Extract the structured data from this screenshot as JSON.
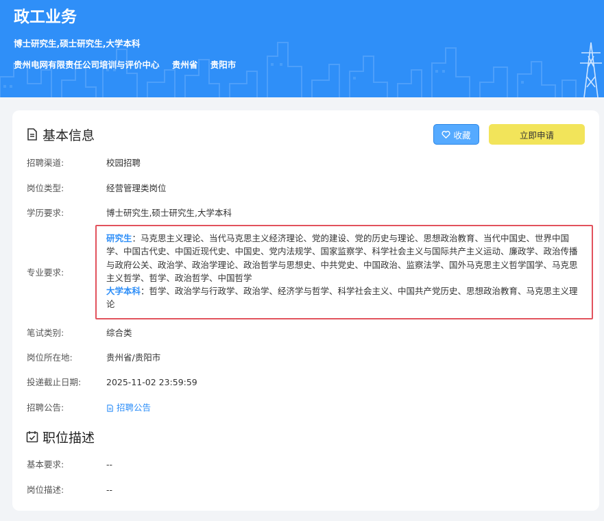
{
  "banner": {
    "title": "政工业务",
    "education": "博士研究生,硕士研究生,大学本科",
    "company": "贵州电网有限责任公司培训与评价中心",
    "province": "贵州省",
    "city": "贵阳市"
  },
  "basic_info": {
    "title": "基本信息",
    "favorite_label": "收藏",
    "apply_label": "立即申请",
    "fields": {
      "channel": {
        "label": "招聘渠道:",
        "value": "校园招聘"
      },
      "position_type": {
        "label": "岗位类型:",
        "value": "经营管理类岗位"
      },
      "education": {
        "label": "学历要求:",
        "value": "博士研究生,硕士研究生,大学本科"
      },
      "major": {
        "label": "专业要求:",
        "graduate_tag": "研究生",
        "graduate_text": "：马克思主义理论、当代马克思主义经济理论、党的建设、党的历史与理论、思想政治教育、当代中国史、世界中国学、中国古代史、中国近现代史、中国史、党内法规学、国家监察学、科学社会主义与国际共产主义运动、廉政学、政治传播与政府公关、政治学、政治学理论、政治哲学与思想史、中共党史、中国政治、监察法学、国外马克思主义哲学国学、马克思主义哲学、哲学、政治哲学、中国哲学",
        "undergrad_tag": "大学本科",
        "undergrad_text": "：哲学、政治学与行政学、政治学、经济学与哲学、科学社会主义、中国共产党历史、思想政治教育、马克思主义理论"
      },
      "exam": {
        "label": "笔试类别:",
        "value": "综合类"
      },
      "location": {
        "label": "岗位所在地:",
        "value": "贵州省/贵阳市"
      },
      "deadline": {
        "label": "投递截止日期:",
        "value": "2025-11-02 23:59:59"
      },
      "notice": {
        "label": "招聘公告:",
        "value": "招聘公告"
      }
    }
  },
  "job_desc": {
    "title": "职位描述",
    "fields": {
      "basic_req": {
        "label": "基本要求:",
        "value": "--"
      },
      "desc": {
        "label": "岗位描述:",
        "value": "--"
      }
    }
  },
  "colors": {
    "brand_blue": "#2f8ff8",
    "apply_yellow": "#f2e45a",
    "highlight_red": "#e2525c"
  },
  "icons": [
    "document-icon",
    "heart-icon",
    "calendar-check-icon",
    "file-link-icon",
    "power-tower-icon"
  ]
}
